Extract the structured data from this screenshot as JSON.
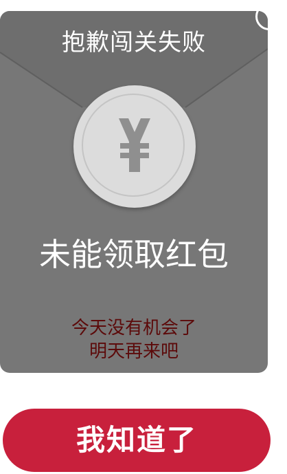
{
  "dialog": {
    "header": "抱歉闯关失败",
    "title": "未能领取红包",
    "message_line1": "今天没有机会了",
    "message_line2": "明天再来吧",
    "coin_icon": "yen-icon",
    "close_icon": "close-icon"
  },
  "actions": {
    "confirm_label": "我知道了"
  },
  "colors": {
    "envelope": "#777777",
    "button": "#c8203c",
    "message_text": "#5c0a0a",
    "coin": "#dcdcdc"
  }
}
